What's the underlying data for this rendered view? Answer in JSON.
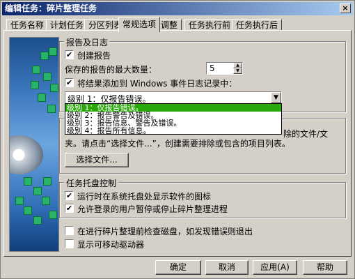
{
  "window": {
    "title": "编辑任务：碎片整理任务",
    "close_glyph": "×"
  },
  "tabs": [
    "任务名称",
    "计划任务",
    "分区列表",
    "常规选项",
    "调整",
    "任务执行前",
    "任务执行后"
  ],
  "active_tab": 3,
  "report": {
    "group_title": "报告及日志",
    "create_report": {
      "label": "创建报告",
      "checked": true
    },
    "max_reports": {
      "label": "保存的报告的最大数量：",
      "value": "5"
    },
    "add_to_log": {
      "label": "将结果添加到 Windows 事件日志记录中：",
      "checked": true
    },
    "level_select": {
      "value": "级别 1：仅报告错误。",
      "options": [
        "级别 1：仅报告错误。",
        "级别 2：报告警告及错误。",
        "级别 3：报告信息、警告及错误。",
        "级别 4：报告所有信息。"
      ],
      "selected_index": 0
    }
  },
  "exclude": {
    "partial_text_right": "除的文件/文",
    "text_line2": "夹。请点击“选择文件...”，创建需要排除或包含的项目列表。",
    "select_files_button": "选择文件..."
  },
  "tray": {
    "group_title": "任务托盘控制",
    "show_icon": {
      "label": "运行时在系统托盘处显示软件的图标",
      "checked": true
    },
    "allow_pause": {
      "label": "允许登录的用户暂停或停止碎片整理进程",
      "checked": true
    }
  },
  "options": {
    "check_disk": {
      "label": "在进行碎片整理前检查磁盘，如发现错误则退出",
      "checked": false
    },
    "show_removable": {
      "label": "显示可移动驱动器",
      "checked": false
    }
  },
  "buttons": {
    "ok": "确定",
    "cancel": "取消",
    "apply": "应用(A)",
    "help": "帮助"
  },
  "colors": {
    "selection_green": "#2aa80a",
    "title_blue": "#0a246a"
  }
}
